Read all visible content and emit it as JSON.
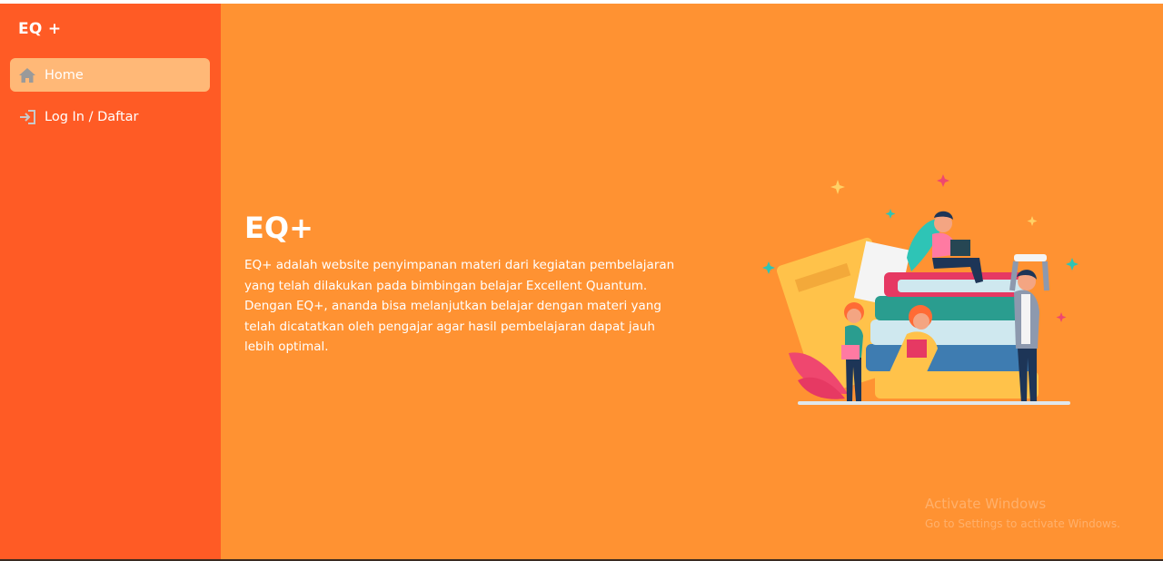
{
  "sidebar": {
    "brand": "EQ +",
    "items": [
      {
        "label": "Home",
        "icon": "home-icon",
        "active": true
      },
      {
        "label": "Log In / Daftar",
        "icon": "login-icon",
        "active": false
      }
    ]
  },
  "hero": {
    "title": "EQ+",
    "description": "EQ+ adalah website penyimpanan materi dari kegiatan pembelajaran yang telah dilakukan pada bimbingan belajar Excellent Quantum. Dengan EQ+, ananda bisa melanjutkan belajar dengan materi yang telah dicatatkan oleh pengajar agar hasil pembelajaran dapat jauh lebih optimal."
  },
  "watermark": {
    "title": "Activate Windows",
    "subtitle": "Go to Settings to activate Windows."
  },
  "colors": {
    "sidebar": "#ff5b25",
    "main": "#ff9232",
    "active_item": "#ffb877"
  }
}
